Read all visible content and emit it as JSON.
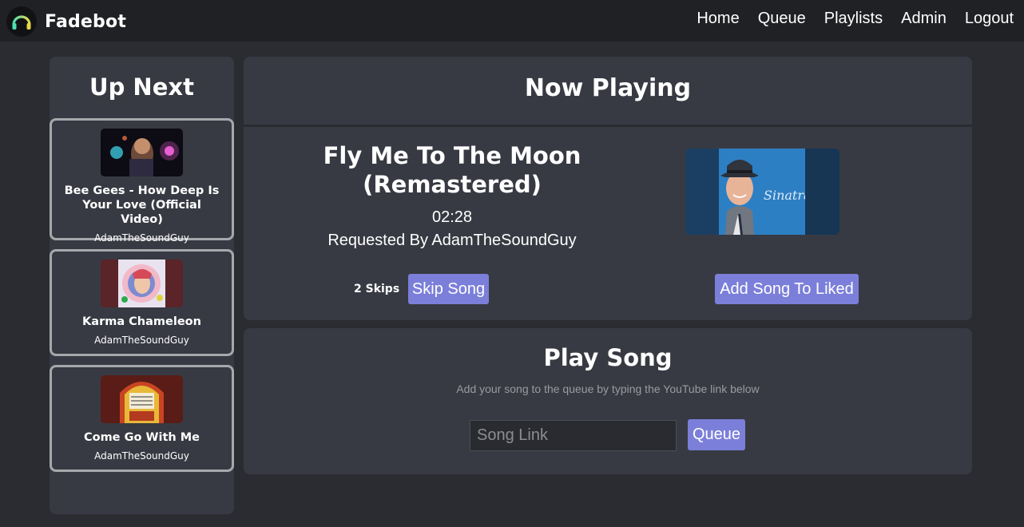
{
  "navbar": {
    "brand": "Fadebot",
    "links": [
      "Home",
      "Queue",
      "Playlists",
      "Admin",
      "Logout"
    ]
  },
  "sidebar": {
    "title": "Up Next",
    "items": [
      {
        "title": "Bee Gees - How Deep Is Your Love (Official Video)",
        "user": "AdamTheSoundGuy"
      },
      {
        "title": "Karma Chameleon",
        "user": "AdamTheSoundGuy"
      },
      {
        "title": "Come Go With Me",
        "user": "AdamTheSoundGuy"
      }
    ]
  },
  "now_playing": {
    "heading": "Now Playing",
    "title": "Fly Me To The Moon (Remastered)",
    "duration": "02:28",
    "requested": "Requested By AdamTheSoundGuy",
    "skips": "2 Skips",
    "skip_label": "Skip Song",
    "like_label": "Add Song To Liked",
    "album_art_text": "Sinatra"
  },
  "play_song": {
    "title": "Play Song",
    "subtitle": "Add your song to the queue by typing the YouTube link below",
    "placeholder": "Song Link",
    "button_label": "Queue"
  },
  "colors": {
    "background": "#2b2c31",
    "navbar": "#202124",
    "panel": "#383a43",
    "accent_button": "#7b7fd9",
    "logo_headphone": "#5ee0a8"
  },
  "icons": {
    "logo": "headphones-icon"
  }
}
